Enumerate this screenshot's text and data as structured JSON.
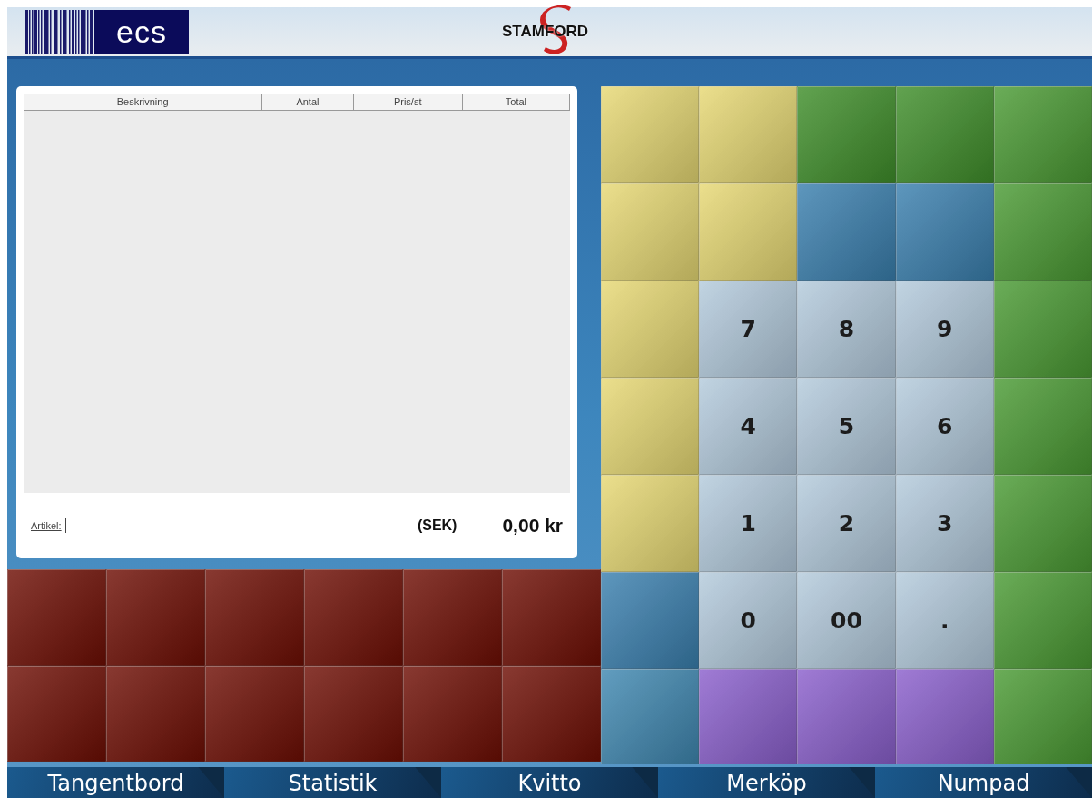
{
  "header": {
    "ecs_logo": "ecs",
    "brand": "STAMFORD"
  },
  "receipt": {
    "columns": [
      "Beskrivning",
      "Antal",
      "Pris/st",
      "Total"
    ],
    "article_label": "Artikel:",
    "currency": "(SEK)",
    "total": "0,00 kr"
  },
  "keypad": [
    {
      "color": "#e6d873"
    },
    {
      "color": "#e6d873"
    },
    {
      "color": "#3f8e2a"
    },
    {
      "color": "#3f8e2a"
    },
    {
      "color": "#4a9a33"
    },
    {
      "color": "#e6d873"
    },
    {
      "color": "#e6d873"
    },
    {
      "color": "#3a7fae"
    },
    {
      "color": "#3a7fae"
    },
    {
      "color": "#4a9a33"
    },
    {
      "color": "#e6d873"
    },
    {
      "label": "7",
      "color": "#b3cadc"
    },
    {
      "label": "8",
      "color": "#b3cadc"
    },
    {
      "label": "9",
      "color": "#b3cadc"
    },
    {
      "color": "#4a9a33"
    },
    {
      "color": "#e6d873"
    },
    {
      "label": "4",
      "color": "#b3cadc"
    },
    {
      "label": "5",
      "color": "#b3cadc"
    },
    {
      "label": "6",
      "color": "#b3cadc"
    },
    {
      "color": "#4a9a33"
    },
    {
      "color": "#e6d873"
    },
    {
      "label": "1",
      "color": "#b3cadc"
    },
    {
      "label": "2",
      "color": "#b3cadc"
    },
    {
      "label": "3",
      "color": "#b3cadc"
    },
    {
      "color": "#4a9a33"
    },
    {
      "color": "#3a7fae"
    },
    {
      "label": "0",
      "color": "#b3cadc"
    },
    {
      "label": "00",
      "color": "#b3cadc"
    },
    {
      "label": ".",
      "color": "#b3cadc"
    },
    {
      "color": "#4a9a33"
    },
    {
      "color": "#3f87b0"
    },
    {
      "color": "#8a5fcc"
    },
    {
      "color": "#8a5fcc"
    },
    {
      "color": "#8a5fcc"
    },
    {
      "color": "#4a9a33"
    }
  ],
  "category_keys": [
    {
      "color": "#6e0e04"
    },
    {
      "color": "#6e0e04"
    },
    {
      "color": "#6e0e04"
    },
    {
      "color": "#6e0e04"
    },
    {
      "color": "#6e0e04"
    },
    {
      "color": "#6e0e04"
    },
    {
      "color": "#6e0e04"
    },
    {
      "color": "#6e0e04"
    },
    {
      "color": "#6e0e04"
    },
    {
      "color": "#6e0e04"
    },
    {
      "color": "#6e0e04"
    },
    {
      "color": "#6e0e04"
    }
  ],
  "tabs": [
    {
      "label": "Tangentbord",
      "selected": false
    },
    {
      "label": "Statistik",
      "selected": false
    },
    {
      "label": "Kvitto",
      "selected": false
    },
    {
      "label": "Merköp",
      "selected": false
    },
    {
      "label": "Numpad",
      "selected": false
    }
  ]
}
